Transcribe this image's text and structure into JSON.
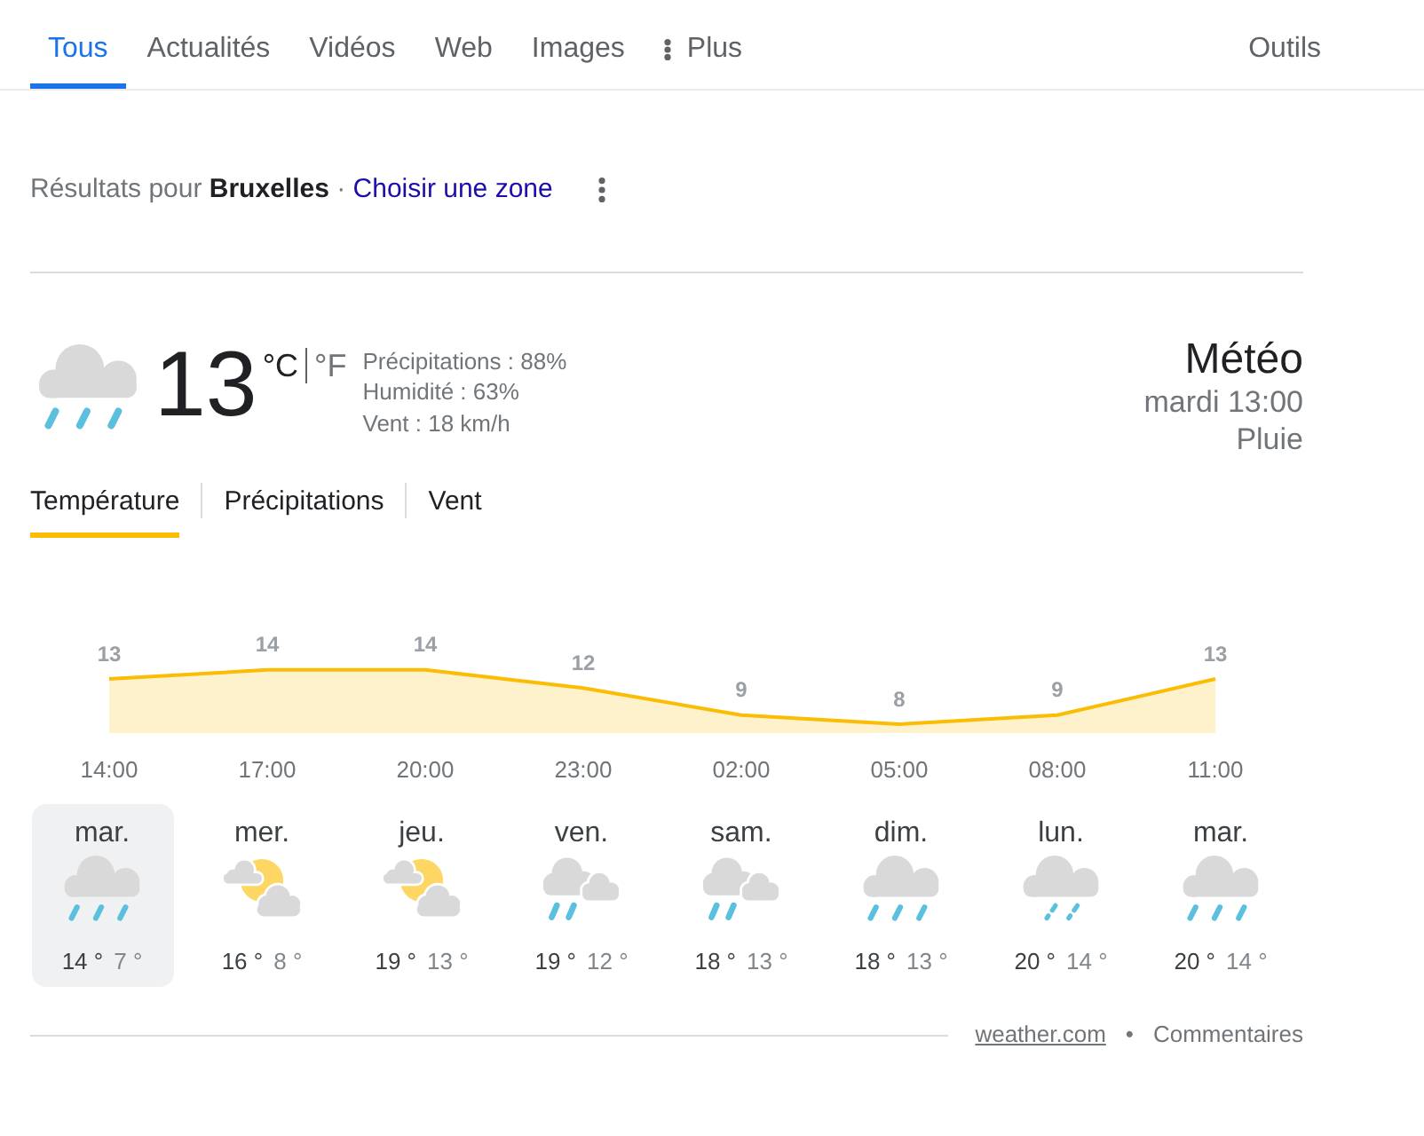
{
  "nav": {
    "tabs": [
      {
        "label": "Tous",
        "kind": "link",
        "selected": true
      },
      {
        "label": "Actualités",
        "kind": "link",
        "selected": false
      },
      {
        "label": "Vidéos",
        "kind": "link",
        "selected": false
      },
      {
        "label": "Web",
        "kind": "link",
        "selected": false
      },
      {
        "label": "Images",
        "kind": "link",
        "selected": false
      },
      {
        "label": "Plus",
        "kind": "menu",
        "selected": false
      }
    ],
    "tools": "Outils"
  },
  "location": {
    "text": "Résultats pour **Bruxelles** ·",
    "link": "Choisir une zone"
  },
  "weather": {
    "temperature": "13",
    "units": [
      {
        "label": "°C",
        "selected": true
      },
      {
        "label": "°F",
        "selected": false
      }
    ],
    "details": [
      "Précipitations : 88%",
      "Humidité : 63%",
      "Vent : 18 km/h"
    ],
    "title": "Météo",
    "time": "mardi 13:00",
    "condition": "Pluie",
    "tabs": [
      {
        "label": "Température",
        "selected": true
      },
      {
        "label": "Précipitations",
        "selected": false
      },
      {
        "label": "Vent",
        "selected": false
      }
    ],
    "chart_data": {
      "type": "area",
      "categories": [
        "14:00",
        "17:00",
        "20:00",
        "23:00",
        "02:00",
        "05:00",
        "08:00",
        "11:00"
      ],
      "series": [
        {
          "color": "#fbbc04",
          "values": [
            13,
            14,
            14,
            12,
            9,
            8,
            9,
            13
          ]
        }
      ],
      "data_labels": true
    },
    "days": [
      {
        "day": "mar.",
        "kind": "rain",
        "high": "14 °",
        "low": "7 °",
        "selected": true
      },
      {
        "day": "mer.",
        "kind": "partly-cloudy",
        "high": "16 °",
        "low": "8 °",
        "selected": false
      },
      {
        "day": "jeu.",
        "kind": "partly-cloudy",
        "high": "19 °",
        "low": "13 °",
        "selected": false
      },
      {
        "day": "ven.",
        "kind": "showers",
        "high": "19 °",
        "low": "12 °",
        "selected": false
      },
      {
        "day": "sam.",
        "kind": "showers",
        "high": "18 °",
        "low": "13 °",
        "selected": false
      },
      {
        "day": "dim.",
        "kind": "rain",
        "high": "18 °",
        "low": "13 °",
        "selected": false
      },
      {
        "day": "lun.",
        "kind": "drizzle",
        "high": "20 °",
        "low": "14 °",
        "selected": false
      },
      {
        "day": "mar.",
        "kind": "rain",
        "high": "20 °",
        "low": "14 °",
        "selected": false
      }
    ],
    "footer": {
      "source": "weather.com",
      "separator": "•",
      "feedback": "Commentaires"
    }
  }
}
